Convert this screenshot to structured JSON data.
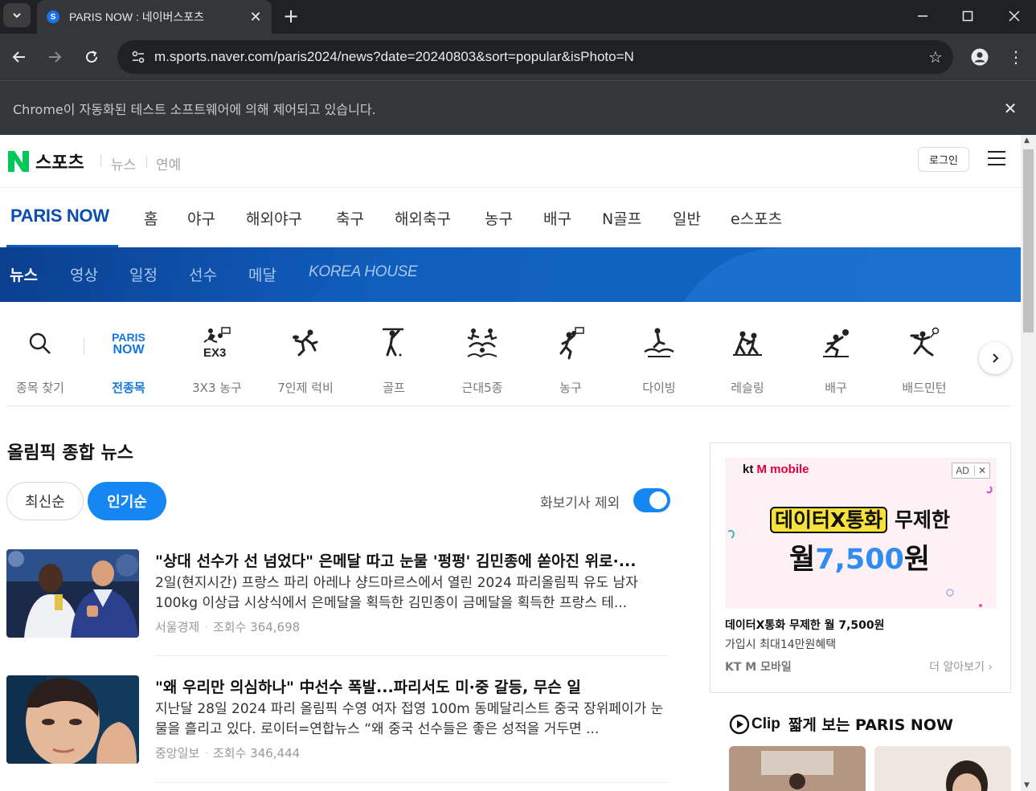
{
  "browser": {
    "tab_title": "PARIS NOW : 네이버스포츠",
    "favicon_letter": "S",
    "url": "m.sports.naver.com/paris2024/news?date=20240803&sort=popular&isPhoto=N",
    "infobar_text": "Chrome이 자동화된 테스트 소프트웨어에 의해 제어되고 있습니다."
  },
  "header": {
    "brand": "스포츠",
    "links": [
      "뉴스",
      "연예"
    ],
    "login_label": "로그인"
  },
  "category_nav": {
    "paris_now": "PARIS NOW",
    "items": [
      "홈",
      "야구",
      "해외야구",
      "축구",
      "해외축구",
      "농구",
      "배구",
      "N골프",
      "일반",
      "e스포츠"
    ]
  },
  "sub_nav": {
    "items": [
      "뉴스",
      "영상",
      "일정",
      "선수",
      "메달"
    ],
    "korea_house": "KOREA HOUSE",
    "active": "뉴스"
  },
  "sports_filter": {
    "search_label": "종목 찾기",
    "paris_now_logo": [
      "PARIS",
      "NOW"
    ],
    "items": [
      "전종목",
      "3X3 농구",
      "7인제 럭비",
      "골프",
      "근대5종",
      "농구",
      "다이빙",
      "레슬링",
      "배구",
      "배드민턴"
    ],
    "active": "전종목",
    "icons": [
      "basketball-3x3-icon",
      "rugby-sevens-icon",
      "golf-icon",
      "modern-pentathlon-icon",
      "basketball-icon",
      "diving-icon",
      "wrestling-icon",
      "volleyball-icon",
      "badminton-icon"
    ]
  },
  "news": {
    "section_title": "올림픽 종합 뉴스",
    "sort_latest": "최신순",
    "sort_popular": "인기순",
    "photo_toggle_label": "화보기사 제외",
    "photo_toggle_on": true,
    "articles": [
      {
        "title": "\"상대 선수가 선 넘었다\" 은메달 따고 눈물 '펑펑' 김민종에 쏟아진 위로·...",
        "summary": "2일(현지시간) 프랑스 파리 아레나 샹드마르스에서 열린 2024 파리올림픽 유도 남자 100kg 이상급 시상식에서 은메달을 획득한 김민종이 금메달을 획득한 프랑스 테...",
        "press": "서울경제",
        "views": "조회수 364,698"
      },
      {
        "title": "\"왜 우리만 의심하나\" 中선수 폭발...파리서도 미·중 갈등, 무슨 일",
        "summary": "지난달 28일 2024 파리 올림픽 수영 여자 접영 100m 동메달리스트 중국 장위페이가 눈물을 흘리고 있다. 로이터=연합뉴스 “왜 중국 선수들은 좋은 성적을 거두면 ...",
        "press": "중앙일보",
        "views": "조회수 346,444"
      }
    ]
  },
  "ad": {
    "brand_kt": "kt",
    "brand_mobile": "M mobile",
    "badge": "AD",
    "headline_highlight": "데이터X통화",
    "headline_rest": " 무제한",
    "price_prefix": "월",
    "price_value": "7,500",
    "price_suffix": "원",
    "title": "데이터X통화 무제한 월 7,500원",
    "subtitle": "가입시 최대14만원혜택",
    "advertiser": "KT M 모바일",
    "more": "더 알아보기 ›"
  },
  "clip": {
    "word": "Clip",
    "title": "짧게 보는 PARIS NOW"
  },
  "colors": {
    "accent_blue": "#1687f2",
    "paris_blue": "#0c4db1",
    "naver_green": "#03c75a"
  }
}
